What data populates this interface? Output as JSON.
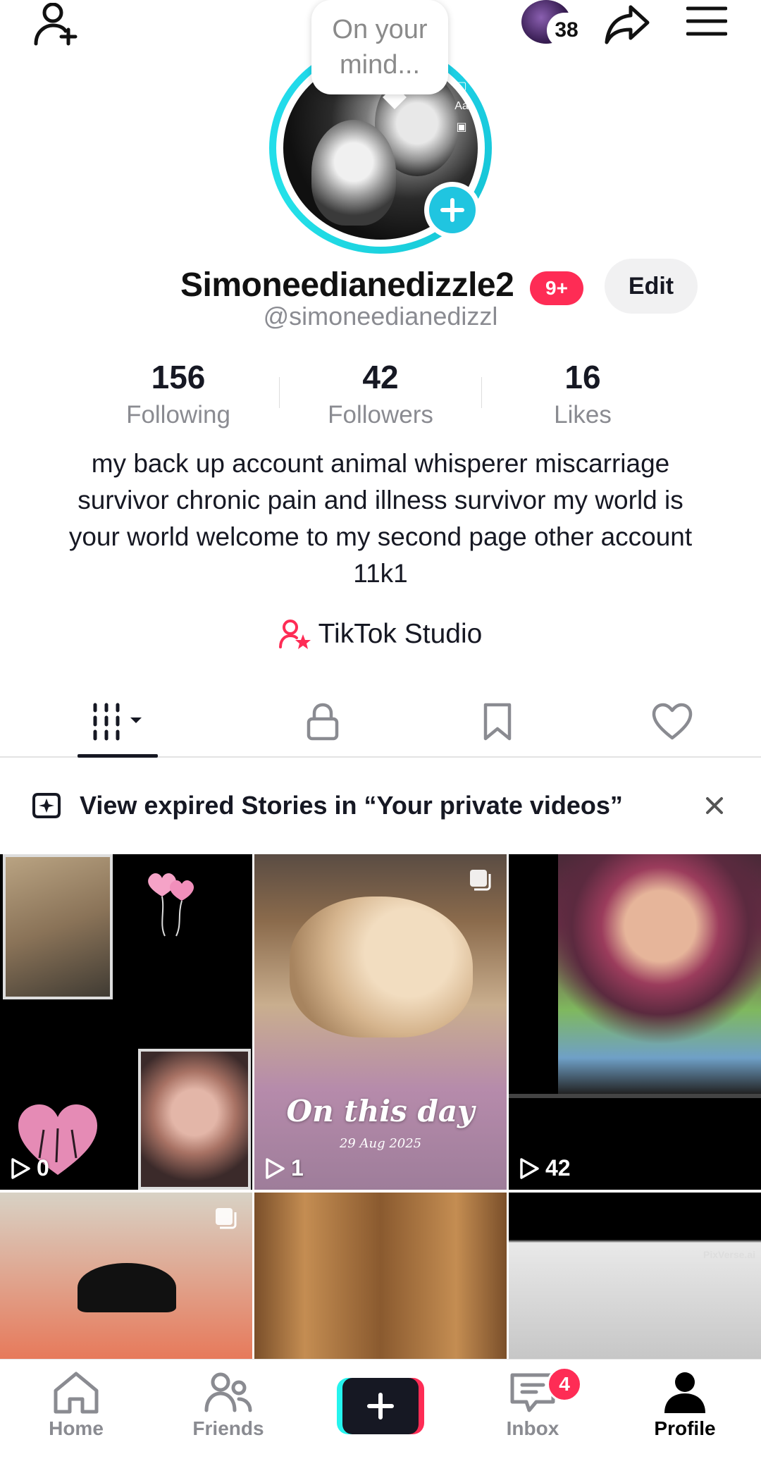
{
  "topbar": {
    "story_count": "38"
  },
  "profile": {
    "status_prompt_line1": "On your",
    "status_prompt_line2": "mind...",
    "username": "Simoneedianedizzle2",
    "notifications_badge": "9+",
    "edit_label": "Edit",
    "handle": "@simoneedianedizzl"
  },
  "stats": [
    {
      "value": "156",
      "label": "Following"
    },
    {
      "value": "42",
      "label": "Followers"
    },
    {
      "value": "16",
      "label": "Likes"
    }
  ],
  "bio": "my back up account animal whisperer miscarriage survivor chronic pain and illness survivor my world is your world welcome to my second page other account 11k1",
  "studio": {
    "label": "TikTok Studio"
  },
  "tabs": [
    {
      "name": "videos",
      "icon": "grid-icon",
      "active": true
    },
    {
      "name": "private",
      "icon": "lock-icon",
      "active": false
    },
    {
      "name": "favorites",
      "icon": "bookmark-icon",
      "active": false
    },
    {
      "name": "liked",
      "icon": "heart-icon",
      "active": false
    }
  ],
  "stories_banner": {
    "text": "View expired Stories in “Your private videos”"
  },
  "videos": [
    {
      "plays": "0"
    },
    {
      "plays": "1",
      "overlay_title": "On this day",
      "overlay_date": "29 Aug 2025"
    },
    {
      "plays": "42"
    },
    {
      "plays": ""
    },
    {
      "plays": ""
    },
    {
      "plays": "",
      "watermark": "PixVerse.ai"
    }
  ],
  "bottom_nav": {
    "home": "Home",
    "friends": "Friends",
    "inbox": "Inbox",
    "inbox_badge": "4",
    "profile": "Profile"
  },
  "colors": {
    "accent_pink": "#fe2c55",
    "accent_cyan": "#20d5ec",
    "text_primary": "#161823",
    "text_secondary": "#8a8b91"
  }
}
